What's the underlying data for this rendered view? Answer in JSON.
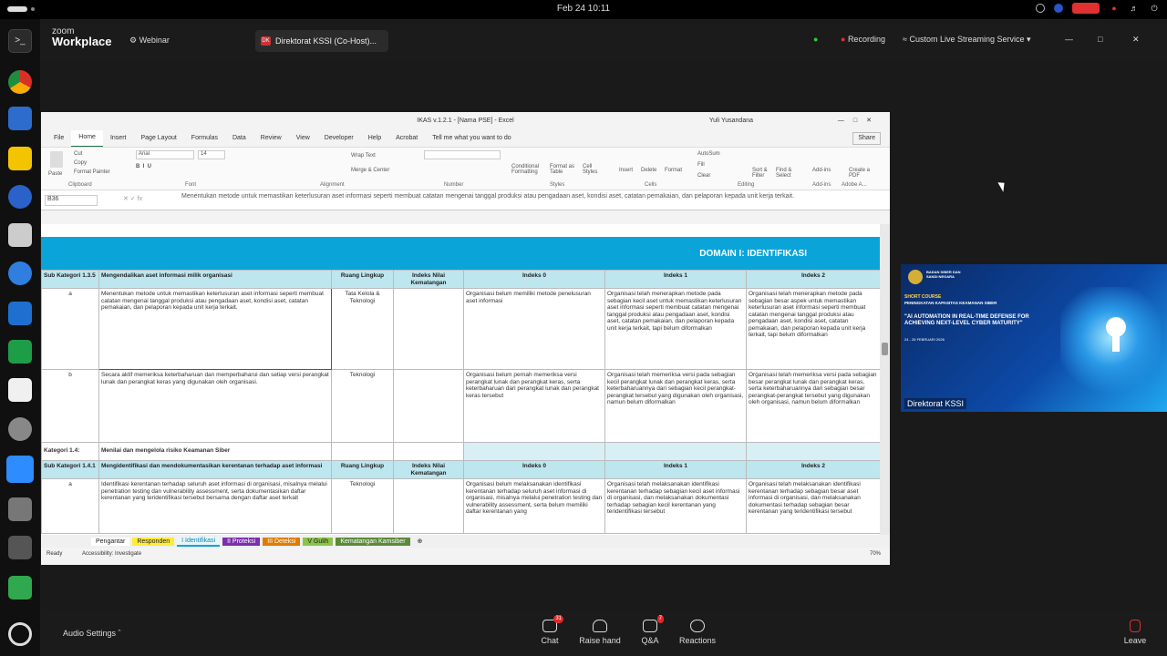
{
  "topbar": {
    "clock": "Feb 24  10:11"
  },
  "zoom": {
    "logo_top": "zoom",
    "logo_bottom": "Workplace",
    "webinar": "Webinar",
    "tab_badge": "DK",
    "tab_label": "Direktorat KSSI (Co-Host)...",
    "recording": "Recording",
    "stream": "Custom Live Streaming Service"
  },
  "excel": {
    "title": "IKAS v.1.2.1 - [Nama PSE] - Excel",
    "user": "Yuli Yusandana",
    "menu": [
      "File",
      "Home",
      "Insert",
      "Page Layout",
      "Formulas",
      "Data",
      "Review",
      "View",
      "Developer",
      "Help",
      "Acrobat",
      "Tell me what you want to do"
    ],
    "share": "Share",
    "ribbon": {
      "cut": "Cut",
      "copy": "Copy",
      "paste": "Paste",
      "format_painter": "Format Painter",
      "font": "Arial",
      "size": "14",
      "wrap": "Wrap Text",
      "merge": "Merge & Center",
      "cond": "Conditional Formatting",
      "fmt_table": "Format as Table",
      "cell_styles": "Cell Styles",
      "insert": "Insert",
      "delete": "Delete",
      "format": "Format",
      "autosum": "AutoSum",
      "fill": "Fill",
      "clear": "Clear",
      "sort": "Sort & Filter",
      "find": "Find & Select",
      "addins": "Add-ins",
      "create_pdf": "Create a PDF",
      "groups": [
        "Clipboard",
        "Font",
        "Alignment",
        "Number",
        "Styles",
        "Cells",
        "Editing",
        "Add-ins",
        "Adobe A..."
      ]
    },
    "namebox": "B36",
    "formula": "Menentukan metode untuk memastikan keterlusuran aset informasi seperti membuat catatan mengenai tanggal produksi atau pengadaan aset, kondisi aset, catatan pemakaian, dan pelaporan kepada unit kerja terkait.",
    "domain_title": "DOMAIN I: IDENTIFIKASI",
    "sec1": {
      "sub": "Sub Kategori 1.3.5",
      "title": "Mengendalikan aset informasi milik organisasi",
      "ruang": "Ruang Lingkup",
      "nilai": "Indeks Nilai Kematangan",
      "i0": "Indeks 0",
      "i1": "Indeks 1",
      "i2": "Indeks 2"
    },
    "row_a": {
      "code": "a",
      "desc": "Menentukan metode untuk memastikan keterlusuran aset informasi seperti membuat catatan mengenai tanggal produksi atau pengadaan aset, kondisi aset, catatan pemakaian, dan pelaporan kepada unit kerja terkait.",
      "scope": "Tata Kelola & Teknologi",
      "i0": "Organisasi belum memiliki metode penelusuran aset informasi",
      "i1": "Organisasi telah menerapkan metode pada sebagian kecil aset untuk memastikan keterlusuran aset informasi seperti membuat catatan mengenai tanggal produksi atau pengadaan aset, kondisi aset, catatan pemakaian, dan pelaporan kepada unit kerja terkait, tapi belum diformalkan",
      "i2": "Organisasi telah menerapkan metode pada sebagian besar aspek untuk memastikan keterlusuran aset informasi seperti membuat catatan mengenai tanggal produksi atau pengadaan aset, kondisi aset, catatan pemakaian, dan pelaporan kepada unit kerja terkait, tapi belum diformalkan"
    },
    "row_b": {
      "code": "b",
      "desc": "Secara aktif memeriksa keterbaharuan dan memperbaharui dan setiap versi perangkat lunak dan perangkat keras yang digunakan oleh organisasi.",
      "scope": "Teknologi",
      "i0": "Organisasi belum pernah memeriksa versi perangkat lunak dan perangkat keras, serta keterbaharuan dari perangkat lunak dan perangkat keras tersebut",
      "i1": "Organisasi telah memeriksa versi pada sebagian kecil perangkat lunak dan perangkat keras, serta keterbaharuannya dari sebagian kecil perangkat-perangkat tersebut yang digunakan oleh organisasi, namun belum diformalkan",
      "i2": "Organisasi telah memeriksa versi pada sebagian besar perangkat lunak dan perangkat keras, serta keterbaharuannya dari sebagian besar perangkat-perangkat tersebut yang digunakan oleh organisasi, namun belum diformalkan"
    },
    "kat": {
      "code": "Kategori 1.4:",
      "title": "Menilai dan mengelola risiko Keamanan Siber"
    },
    "sec2": {
      "sub": "Sub Kategori 1.4.1",
      "title": "Mengidentifikasi dan mendokumentasikan kerentanan terhadap aset informasi",
      "ruang": "Ruang Lingkup",
      "nilai": "Indeks Nilai Kematangan",
      "i0": "Indeks 0",
      "i1": "Indeks 1",
      "i2": "Indeks 2"
    },
    "row_a2": {
      "code": "a",
      "desc": "Identifikasi kerentanan terhadap seluruh aset informasi di organisasi, misalnya melalui penetration testing dan vulnerability assessment, serta dokumentasikan daftar kerentanan yang teridentifikasi tersebut bersama dengan daftar aset terkait",
      "scope": "Teknologi",
      "i0": "Organisasi belum melaksanakan identifikasi kerentanan terhadap seluruh aset informasi di organisasi, misalnya melalui penetration testing dan vulnerability assessment, serta belum memiliki daftar kerentanan yang",
      "i1": "Organisasi telah melaksanakan identifikasi kerentanan terhadap sebagian kecil aset informasi di organisasi, dan melaksanakan dokumentasi terhadap sebagian kecil kerentanan yang teridentifikasi tersebut",
      "i2": "Organisasi telah melaksanakan identifikasi kerentanan terhadap sebagian besar aset informasi di organisasi, dan melaksanakan dokumentasi terhadap sebagian besar kerentanan yang teridentifikasi tersebut"
    },
    "sheet_tabs": [
      "Pengantar",
      "Responden",
      "I Identifikasi",
      "II Proteksi",
      "III Deteksi",
      "V Gulih",
      "Kematangan Kamsiber"
    ],
    "status_ready": "Ready",
    "status_access": "Accessibility: Investigate",
    "zoom_level": "70%"
  },
  "thumbnail": {
    "org": "BADAN SIBER DAN SANDI NEGARA",
    "course": "SHORT COURSE",
    "course_sub": "PENINGKATAN KAPASITAS KEAMANAN SIBER",
    "headline": "\"AI AUTOMATION IN REAL-TIME DEFENSE FOR ACHIEVING NEXT-LEVEL CYBER MATURITY\"",
    "dates": "24 - 26 FEBRUARI 2026",
    "name": "Direktorat KSSI"
  },
  "footer": {
    "audio": "Audio Settings",
    "chat": "Chat",
    "chat_count": "31",
    "raise": "Raise hand",
    "qa": "Q&A",
    "qa_count": "7",
    "reactions": "Reactions",
    "leave": "Leave"
  }
}
